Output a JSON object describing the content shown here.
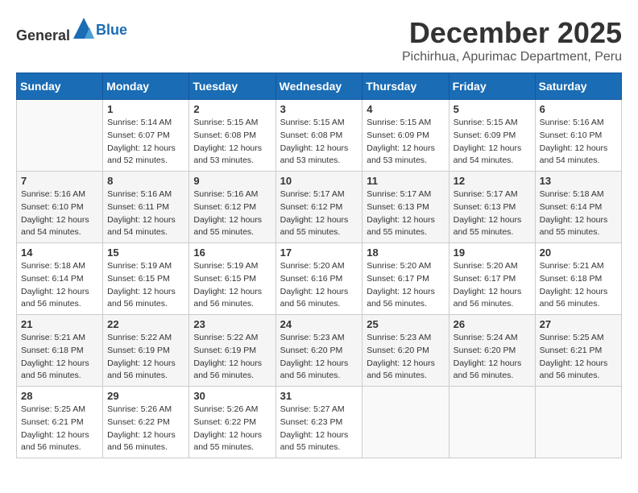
{
  "header": {
    "logo_general": "General",
    "logo_blue": "Blue",
    "month_title": "December 2025",
    "location": "Pichirhua, Apurimac Department, Peru"
  },
  "days_of_week": [
    "Sunday",
    "Monday",
    "Tuesday",
    "Wednesday",
    "Thursday",
    "Friday",
    "Saturday"
  ],
  "weeks": [
    [
      {
        "day": "",
        "sunrise": "",
        "sunset": "",
        "daylight": ""
      },
      {
        "day": "1",
        "sunrise": "Sunrise: 5:14 AM",
        "sunset": "Sunset: 6:07 PM",
        "daylight": "Daylight: 12 hours and 52 minutes."
      },
      {
        "day": "2",
        "sunrise": "Sunrise: 5:15 AM",
        "sunset": "Sunset: 6:08 PM",
        "daylight": "Daylight: 12 hours and 53 minutes."
      },
      {
        "day": "3",
        "sunrise": "Sunrise: 5:15 AM",
        "sunset": "Sunset: 6:08 PM",
        "daylight": "Daylight: 12 hours and 53 minutes."
      },
      {
        "day": "4",
        "sunrise": "Sunrise: 5:15 AM",
        "sunset": "Sunset: 6:09 PM",
        "daylight": "Daylight: 12 hours and 53 minutes."
      },
      {
        "day": "5",
        "sunrise": "Sunrise: 5:15 AM",
        "sunset": "Sunset: 6:09 PM",
        "daylight": "Daylight: 12 hours and 54 minutes."
      },
      {
        "day": "6",
        "sunrise": "Sunrise: 5:16 AM",
        "sunset": "Sunset: 6:10 PM",
        "daylight": "Daylight: 12 hours and 54 minutes."
      }
    ],
    [
      {
        "day": "7",
        "sunrise": "Sunrise: 5:16 AM",
        "sunset": "Sunset: 6:10 PM",
        "daylight": "Daylight: 12 hours and 54 minutes."
      },
      {
        "day": "8",
        "sunrise": "Sunrise: 5:16 AM",
        "sunset": "Sunset: 6:11 PM",
        "daylight": "Daylight: 12 hours and 54 minutes."
      },
      {
        "day": "9",
        "sunrise": "Sunrise: 5:16 AM",
        "sunset": "Sunset: 6:12 PM",
        "daylight": "Daylight: 12 hours and 55 minutes."
      },
      {
        "day": "10",
        "sunrise": "Sunrise: 5:17 AM",
        "sunset": "Sunset: 6:12 PM",
        "daylight": "Daylight: 12 hours and 55 minutes."
      },
      {
        "day": "11",
        "sunrise": "Sunrise: 5:17 AM",
        "sunset": "Sunset: 6:13 PM",
        "daylight": "Daylight: 12 hours and 55 minutes."
      },
      {
        "day": "12",
        "sunrise": "Sunrise: 5:17 AM",
        "sunset": "Sunset: 6:13 PM",
        "daylight": "Daylight: 12 hours and 55 minutes."
      },
      {
        "day": "13",
        "sunrise": "Sunrise: 5:18 AM",
        "sunset": "Sunset: 6:14 PM",
        "daylight": "Daylight: 12 hours and 55 minutes."
      }
    ],
    [
      {
        "day": "14",
        "sunrise": "Sunrise: 5:18 AM",
        "sunset": "Sunset: 6:14 PM",
        "daylight": "Daylight: 12 hours and 56 minutes."
      },
      {
        "day": "15",
        "sunrise": "Sunrise: 5:19 AM",
        "sunset": "Sunset: 6:15 PM",
        "daylight": "Daylight: 12 hours and 56 minutes."
      },
      {
        "day": "16",
        "sunrise": "Sunrise: 5:19 AM",
        "sunset": "Sunset: 6:15 PM",
        "daylight": "Daylight: 12 hours and 56 minutes."
      },
      {
        "day": "17",
        "sunrise": "Sunrise: 5:20 AM",
        "sunset": "Sunset: 6:16 PM",
        "daylight": "Daylight: 12 hours and 56 minutes."
      },
      {
        "day": "18",
        "sunrise": "Sunrise: 5:20 AM",
        "sunset": "Sunset: 6:17 PM",
        "daylight": "Daylight: 12 hours and 56 minutes."
      },
      {
        "day": "19",
        "sunrise": "Sunrise: 5:20 AM",
        "sunset": "Sunset: 6:17 PM",
        "daylight": "Daylight: 12 hours and 56 minutes."
      },
      {
        "day": "20",
        "sunrise": "Sunrise: 5:21 AM",
        "sunset": "Sunset: 6:18 PM",
        "daylight": "Daylight: 12 hours and 56 minutes."
      }
    ],
    [
      {
        "day": "21",
        "sunrise": "Sunrise: 5:21 AM",
        "sunset": "Sunset: 6:18 PM",
        "daylight": "Daylight: 12 hours and 56 minutes."
      },
      {
        "day": "22",
        "sunrise": "Sunrise: 5:22 AM",
        "sunset": "Sunset: 6:19 PM",
        "daylight": "Daylight: 12 hours and 56 minutes."
      },
      {
        "day": "23",
        "sunrise": "Sunrise: 5:22 AM",
        "sunset": "Sunset: 6:19 PM",
        "daylight": "Daylight: 12 hours and 56 minutes."
      },
      {
        "day": "24",
        "sunrise": "Sunrise: 5:23 AM",
        "sunset": "Sunset: 6:20 PM",
        "daylight": "Daylight: 12 hours and 56 minutes."
      },
      {
        "day": "25",
        "sunrise": "Sunrise: 5:23 AM",
        "sunset": "Sunset: 6:20 PM",
        "daylight": "Daylight: 12 hours and 56 minutes."
      },
      {
        "day": "26",
        "sunrise": "Sunrise: 5:24 AM",
        "sunset": "Sunset: 6:20 PM",
        "daylight": "Daylight: 12 hours and 56 minutes."
      },
      {
        "day": "27",
        "sunrise": "Sunrise: 5:25 AM",
        "sunset": "Sunset: 6:21 PM",
        "daylight": "Daylight: 12 hours and 56 minutes."
      }
    ],
    [
      {
        "day": "28",
        "sunrise": "Sunrise: 5:25 AM",
        "sunset": "Sunset: 6:21 PM",
        "daylight": "Daylight: 12 hours and 56 minutes."
      },
      {
        "day": "29",
        "sunrise": "Sunrise: 5:26 AM",
        "sunset": "Sunset: 6:22 PM",
        "daylight": "Daylight: 12 hours and 56 minutes."
      },
      {
        "day": "30",
        "sunrise": "Sunrise: 5:26 AM",
        "sunset": "Sunset: 6:22 PM",
        "daylight": "Daylight: 12 hours and 55 minutes."
      },
      {
        "day": "31",
        "sunrise": "Sunrise: 5:27 AM",
        "sunset": "Sunset: 6:23 PM",
        "daylight": "Daylight: 12 hours and 55 minutes."
      },
      {
        "day": "",
        "sunrise": "",
        "sunset": "",
        "daylight": ""
      },
      {
        "day": "",
        "sunrise": "",
        "sunset": "",
        "daylight": ""
      },
      {
        "day": "",
        "sunrise": "",
        "sunset": "",
        "daylight": ""
      }
    ]
  ]
}
